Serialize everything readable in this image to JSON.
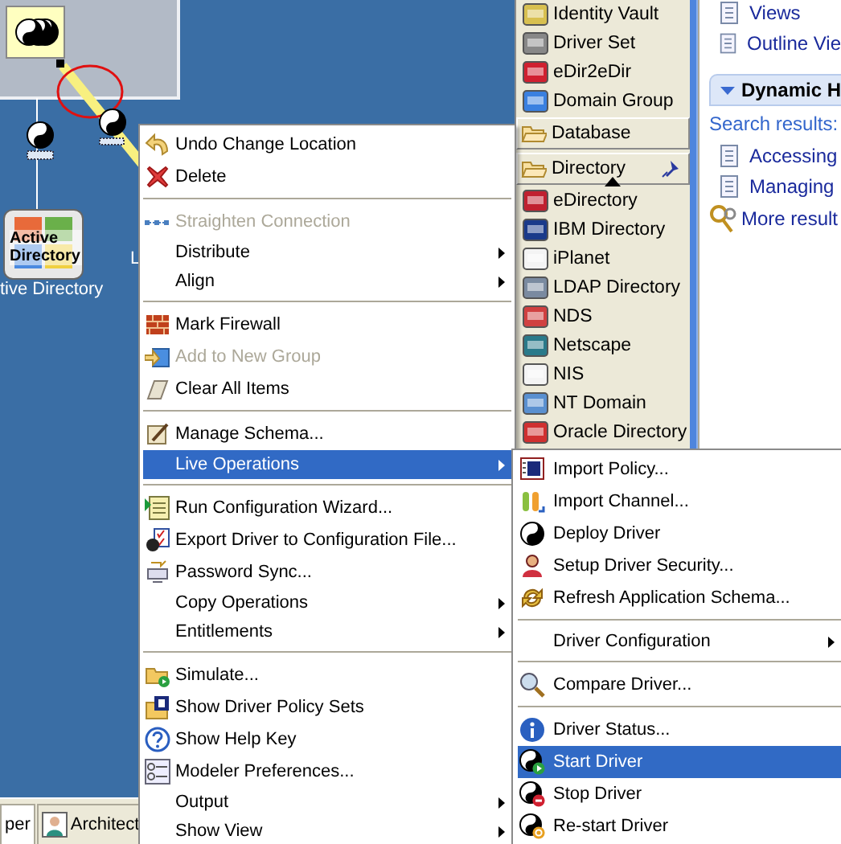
{
  "canvas": {
    "logo_text": "Active Directory",
    "labels": [
      "tive Directory",
      "L"
    ]
  },
  "bottom_tabs": [
    {
      "label": "per",
      "selected": true
    },
    {
      "label": "Architect",
      "selected": false
    }
  ],
  "palette": [
    {
      "label": "Identity Vault",
      "kind": "driver"
    },
    {
      "label": "Driver Set",
      "kind": "driver"
    },
    {
      "label": "eDir2eDir",
      "kind": "driver"
    },
    {
      "label": "Domain Group",
      "kind": "driver"
    },
    {
      "label": "Database",
      "kind": "drawer",
      "pinned": false
    },
    {
      "label": "Directory",
      "kind": "drawer",
      "pinned": true
    },
    {
      "label": "eDirectory",
      "kind": "driver"
    },
    {
      "label": "IBM Directory",
      "kind": "driver"
    },
    {
      "label": "iPlanet",
      "kind": "driver"
    },
    {
      "label": "LDAP Directory",
      "kind": "driver"
    },
    {
      "label": "NDS",
      "kind": "driver"
    },
    {
      "label": "Netscape",
      "kind": "driver"
    },
    {
      "label": "NIS",
      "kind": "driver"
    },
    {
      "label": "NT Domain",
      "kind": "driver"
    },
    {
      "label": "Oracle Directory",
      "kind": "driver"
    }
  ],
  "help_panel": {
    "links": [
      "Views",
      "Outline Vie"
    ],
    "section": {
      "title": "Dynamic H",
      "expanded": true
    },
    "search_label": "Search results:",
    "results": [
      "Accessing",
      "Managing"
    ],
    "more": "More result"
  },
  "context_menu": [
    {
      "kind": "item",
      "label": "Undo Change Location",
      "disabled": false,
      "selected": false,
      "has_submenu": false
    },
    {
      "kind": "item",
      "label": "Delete",
      "disabled": false,
      "selected": false,
      "has_submenu": false
    },
    {
      "kind": "separator"
    },
    {
      "kind": "item",
      "label": "Straighten Connection",
      "disabled": true,
      "selected": false,
      "has_submenu": false
    },
    {
      "kind": "item",
      "label": "Distribute",
      "disabled": false,
      "selected": false,
      "has_submenu": true
    },
    {
      "kind": "item",
      "label": "Align",
      "disabled": false,
      "selected": false,
      "has_submenu": true
    },
    {
      "kind": "separator"
    },
    {
      "kind": "item",
      "label": "Mark Firewall",
      "disabled": false,
      "selected": false,
      "has_submenu": false
    },
    {
      "kind": "item",
      "label": "Add to New Group",
      "disabled": true,
      "selected": false,
      "has_submenu": false
    },
    {
      "kind": "item",
      "label": "Clear All Items",
      "disabled": false,
      "selected": false,
      "has_submenu": false
    },
    {
      "kind": "separator"
    },
    {
      "kind": "item",
      "label": "Manage Schema...",
      "disabled": false,
      "selected": false,
      "has_submenu": false
    },
    {
      "kind": "item",
      "label": "Live Operations",
      "disabled": false,
      "selected": true,
      "has_submenu": true
    },
    {
      "kind": "separator"
    },
    {
      "kind": "item",
      "label": "Run Configuration Wizard...",
      "disabled": false,
      "selected": false,
      "has_submenu": false
    },
    {
      "kind": "item",
      "label": "Export Driver to Configuration File...",
      "disabled": false,
      "selected": false,
      "has_submenu": false
    },
    {
      "kind": "item",
      "label": "Password Sync...",
      "disabled": false,
      "selected": false,
      "has_submenu": false
    },
    {
      "kind": "item",
      "label": "Copy Operations",
      "disabled": false,
      "selected": false,
      "has_submenu": true
    },
    {
      "kind": "item",
      "label": "Entitlements",
      "disabled": false,
      "selected": false,
      "has_submenu": true
    },
    {
      "kind": "separator"
    },
    {
      "kind": "item",
      "label": "Simulate...",
      "disabled": false,
      "selected": false,
      "has_submenu": false
    },
    {
      "kind": "item",
      "label": "Show Driver Policy Sets",
      "disabled": false,
      "selected": false,
      "has_submenu": false
    },
    {
      "kind": "item",
      "label": "Show Help Key",
      "disabled": false,
      "selected": false,
      "has_submenu": false
    },
    {
      "kind": "item",
      "label": "Modeler Preferences...",
      "disabled": false,
      "selected": false,
      "has_submenu": false
    },
    {
      "kind": "item",
      "label": "Output",
      "disabled": false,
      "selected": false,
      "has_submenu": true
    },
    {
      "kind": "item",
      "label": "Show View",
      "disabled": false,
      "selected": false,
      "has_submenu": true
    }
  ],
  "submenu": [
    {
      "kind": "item",
      "label": "Import Policy...",
      "disabled": false,
      "selected": false,
      "has_submenu": false
    },
    {
      "kind": "item",
      "label": "Import Channel...",
      "disabled": false,
      "selected": false,
      "has_submenu": false
    },
    {
      "kind": "item",
      "label": "Deploy Driver",
      "disabled": false,
      "selected": false,
      "has_submenu": false
    },
    {
      "kind": "item",
      "label": "Setup Driver Security...",
      "disabled": false,
      "selected": false,
      "has_submenu": false
    },
    {
      "kind": "item",
      "label": "Refresh Application Schema...",
      "disabled": false,
      "selected": false,
      "has_submenu": false
    },
    {
      "kind": "separator"
    },
    {
      "kind": "item",
      "label": "Driver Configuration",
      "disabled": false,
      "selected": false,
      "has_submenu": true
    },
    {
      "kind": "separator"
    },
    {
      "kind": "item",
      "label": "Compare Driver...",
      "disabled": false,
      "selected": false,
      "has_submenu": false
    },
    {
      "kind": "separator"
    },
    {
      "kind": "item",
      "label": "Driver Status...",
      "disabled": false,
      "selected": false,
      "has_submenu": false
    },
    {
      "kind": "item",
      "label": "Start Driver",
      "disabled": false,
      "selected": true,
      "has_submenu": false
    },
    {
      "kind": "item",
      "label": "Stop Driver",
      "disabled": false,
      "selected": false,
      "has_submenu": false
    },
    {
      "kind": "item",
      "label": "Re-start Driver",
      "disabled": false,
      "selected": false,
      "has_submenu": false
    }
  ]
}
